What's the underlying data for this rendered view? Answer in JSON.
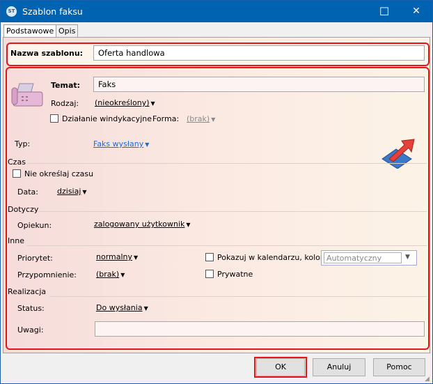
{
  "window": {
    "title": "Szablon faksu",
    "logo": "ST",
    "minimize": "—",
    "maximize": "☐",
    "close": "✕"
  },
  "tabs": [
    {
      "label": "Podstawowe",
      "active": true
    },
    {
      "label": "Opis",
      "active": false
    }
  ],
  "template_name": {
    "label": "Nazwa szablonu:",
    "value": "Oferta handlowa"
  },
  "main": {
    "subject": {
      "label": "Temat:",
      "value": "Faks"
    },
    "kind": {
      "label": "Rodzaj:",
      "value": "(nieokreślony)"
    },
    "collection": {
      "label": "Działanie windykacyjne",
      "checked": false
    },
    "form": {
      "label": "Forma:",
      "value": "(brak)"
    },
    "type": {
      "label": "Typ:",
      "value": "Faks wysłany"
    },
    "icons": {
      "fax": "fax-icon",
      "send": "send-arrow-icon"
    }
  },
  "time": {
    "section": "Czas",
    "no_time": {
      "label": "Nie określaj czasu",
      "checked": false
    },
    "date": {
      "label": "Data:",
      "value": "dzisiaj"
    }
  },
  "concerns": {
    "section": "Dotyczy",
    "keeper": {
      "label": "Opiekun:",
      "value": "zalogowany użytkownik"
    }
  },
  "other": {
    "section": "Inne",
    "priority": {
      "label": "Priorytet:",
      "value": "normalny"
    },
    "reminder": {
      "label": "Przypomnienie:",
      "value": "(brak)"
    },
    "calendar": {
      "label": "Pokazuj w kalendarzu, kolor:",
      "checked": false,
      "color": "Automatyczny"
    },
    "private": {
      "label": "Prywatne",
      "checked": false
    }
  },
  "realization": {
    "section": "Realizacja",
    "status": {
      "label": "Status:",
      "value": "Do wysłania"
    },
    "notes": {
      "label": "Uwagi:",
      "value": ""
    }
  },
  "buttons": {
    "ok": "OK",
    "cancel": "Anuluj",
    "help": "Pomoc"
  },
  "colors": {
    "titlebar": "#0063b1",
    "highlight": "#e8141b",
    "link": "#1c6ccf"
  }
}
